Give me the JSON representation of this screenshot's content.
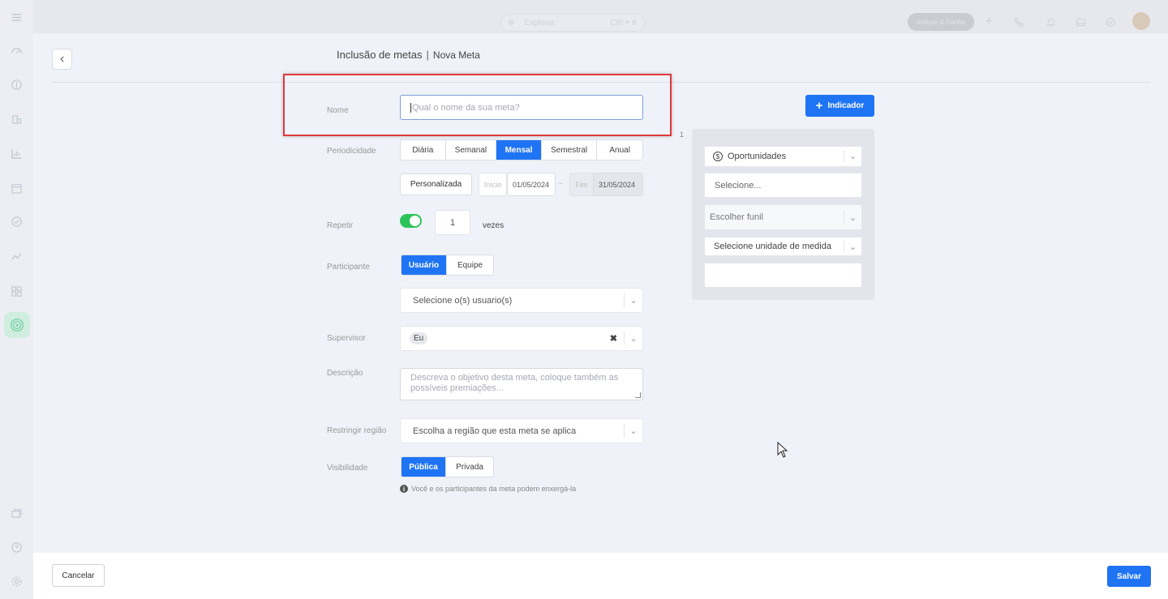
{
  "topbar": {
    "search_placeholder": "Explorar",
    "search_shortcut": "Ctrl + K",
    "indique_label": "Indique & Ganhe"
  },
  "header": {
    "title": "Inclusão de metas",
    "separator": "|",
    "subtitle": "Nova Meta"
  },
  "form": {
    "name": {
      "label": "Nome",
      "placeholder": "Qual o nome da sua meta?"
    },
    "period": {
      "label": "Periodicidade",
      "options": [
        "Diária",
        "Semanal",
        "Mensal",
        "Semestral",
        "Anual"
      ],
      "selected": "Mensal",
      "custom_label": "Personalizada",
      "start_label": "Início",
      "start_value": "01/05/2024",
      "range_sep": "–",
      "end_label": "Fim",
      "end_value": "31/05/2024"
    },
    "repeat": {
      "label": "Repetir",
      "enabled": true,
      "value": "1",
      "suffix": "vezes"
    },
    "participant": {
      "label": "Participante",
      "options": [
        "Usuário",
        "Equipe"
      ],
      "selected": "Usuário",
      "users_placeholder": "Selecione o(s) usuario(s)"
    },
    "supervisor": {
      "label": "Supervisor",
      "value": "Eu",
      "clear_glyph": "✖"
    },
    "description": {
      "label": "Descrição",
      "placeholder": "Descreva o objetivo desta meta, coloque também as possíveis premiações..."
    },
    "region": {
      "label": "Restringir região",
      "placeholder": "Escolha a região que esta meta se aplica"
    },
    "visibility": {
      "label": "Visibilidade",
      "options": [
        "Pública",
        "Privada"
      ],
      "selected": "Pública",
      "hint": "Você e os participantes da meta podem enxergá-la"
    }
  },
  "indicator": {
    "add_label": "Indicador",
    "index": "1",
    "type": "Oportunidades",
    "select_placeholder": "Selecione...",
    "funnel_placeholder": "Escolher funil",
    "unit_placeholder": "Selecione unidade de medida"
  },
  "footer": {
    "cancel_label": "Cancelar",
    "save_label": "Salvar"
  },
  "colors": {
    "primary": "#1f74f4",
    "toggle_on": "#2ec35a",
    "highlight": "#e0393e"
  }
}
